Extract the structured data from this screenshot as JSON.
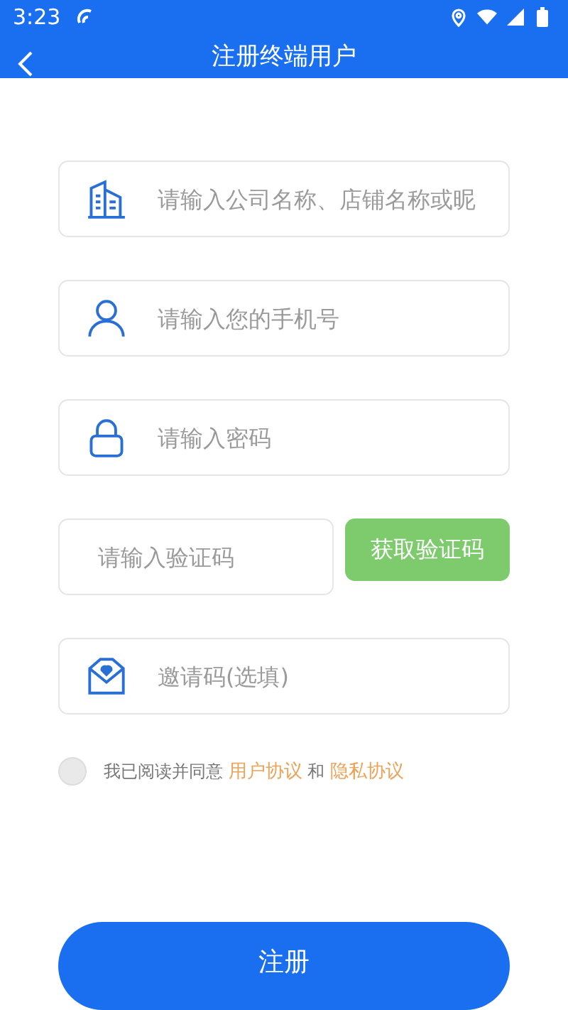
{
  "status_bar": {
    "time": "3:23"
  },
  "nav": {
    "title": "注册终端用户"
  },
  "fields": [
    {
      "kind": "company",
      "placeholder": "请输入公司名称、店铺名称或昵"
    },
    {
      "kind": "phone",
      "placeholder": "请输入您的手机号"
    },
    {
      "kind": "password",
      "placeholder": "请输入密码"
    }
  ],
  "verify": {
    "placeholder": "请输入验证码",
    "button": "获取验证码"
  },
  "invite": {
    "kind": "invite",
    "placeholder": "邀请码(选填)"
  },
  "agreement": {
    "checked": false,
    "prefix": "我已阅读并同意",
    "link_1": "用户协议",
    "joiner": "和",
    "link_2": "隐私协议"
  },
  "submit": "注册"
}
